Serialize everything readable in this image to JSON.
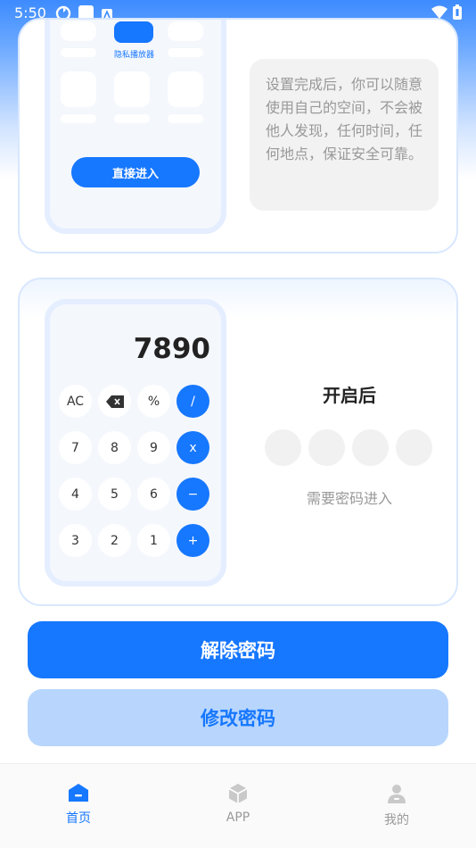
{
  "status_bar": {
    "time": "5:50",
    "icons": [
      "sync-icon",
      "square-app-icon",
      "a-badge-icon",
      "wifi-icon",
      "battery-icon"
    ]
  },
  "card_top": {
    "app_label": "隐私播放器",
    "enter_button": "直接进入",
    "description": "设置完成后，你可以随意使用自己的空间，不会被他人发现，任何时间，任何地点，保证安全可靠。"
  },
  "card_calc": {
    "display": "7890",
    "keys": [
      "AC",
      "⌫",
      "%",
      "/",
      "7",
      "8",
      "9",
      "x",
      "4",
      "5",
      "6",
      "−",
      "3",
      "2",
      "1",
      "+"
    ],
    "after_title": "开启后",
    "need_password": "需要密码进入"
  },
  "actions": {
    "remove_password": "解除密码",
    "modify_password": "修改密码"
  },
  "bottom_nav": {
    "home": "首页",
    "app": "APP",
    "mine": "我的"
  },
  "colors": {
    "accent": "#1677ff",
    "accent_light": "#b8d6fd",
    "nav_active": "#1677ff",
    "nav_inactive": "#9a9a9a"
  }
}
